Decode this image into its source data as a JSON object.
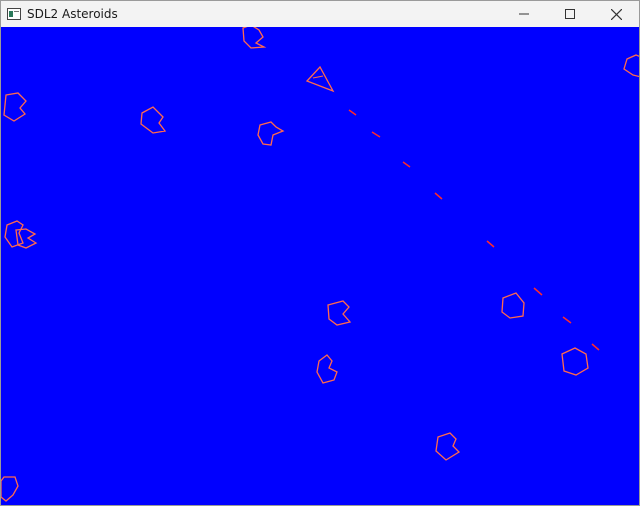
{
  "window": {
    "title": "SDL2 Asteroids",
    "icon": "window-app-icon"
  },
  "controls": [
    {
      "name": "minimize-button",
      "icon": "minimize-icon"
    },
    {
      "name": "maximize-button",
      "icon": "maximize-icon"
    },
    {
      "name": "close-button",
      "icon": "close-icon"
    }
  ],
  "game": {
    "background_color": "#0000ff",
    "line_color": "#ff6a4d",
    "bullet_color": "#ff2a2a"
  }
}
